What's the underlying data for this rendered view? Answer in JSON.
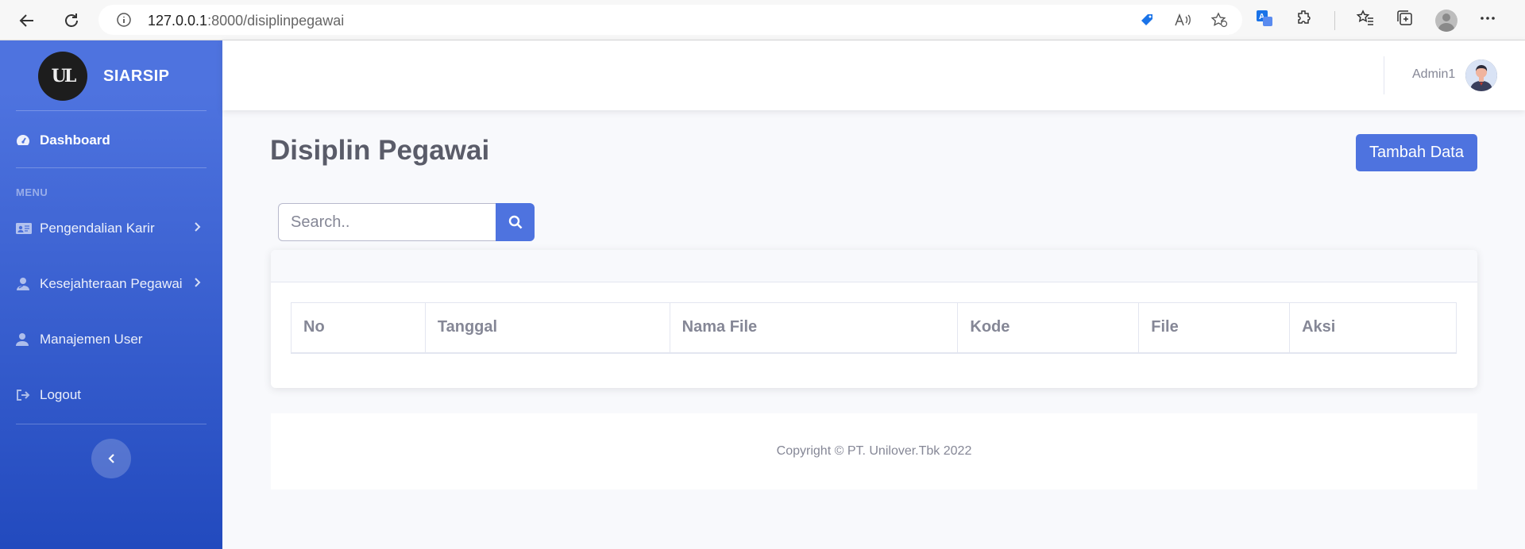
{
  "browser": {
    "url_host": "127.0.0.1",
    "url_rest": ":8000/disiplinpegawai"
  },
  "sidebar": {
    "brand": "SIARSIP",
    "logo_text": "UL",
    "dashboard": "Dashboard",
    "menu_heading": "MENU",
    "items": [
      {
        "label": "Pengendalian Karir",
        "icon": "id-card-icon"
      },
      {
        "label": "Kesejahteraan Pegawai",
        "icon": "user-injured-icon"
      },
      {
        "label": "Manajemen User",
        "icon": "user-icon"
      },
      {
        "label": "Logout",
        "icon": "sign-out-icon"
      }
    ]
  },
  "topbar": {
    "user": "Admin1"
  },
  "page": {
    "title": "Disiplin Pegawai",
    "add_button": "Tambah Data",
    "search_placeholder": "Search.."
  },
  "table": {
    "columns": [
      "No",
      "Tanggal",
      "Nama File",
      "Kode",
      "File",
      "Aksi"
    ]
  },
  "footer": {
    "copyright": "Copyright © PT. Unilover.Tbk 2022"
  },
  "colors": {
    "primary": "#4e73df",
    "sidebar_end": "#224abe",
    "text_muted": "#858796"
  }
}
